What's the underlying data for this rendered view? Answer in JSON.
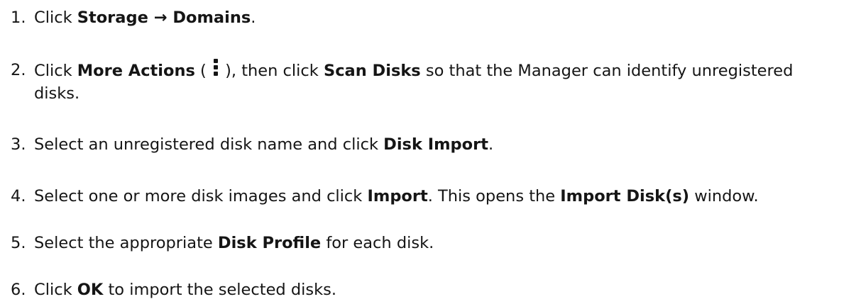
{
  "steps": [
    {
      "number": "1.",
      "t1": "Click ",
      "b1": "Storage → Domains",
      "t2": "."
    },
    {
      "number": "2.",
      "t1": "Click ",
      "b1": "More Actions",
      "t2": " ( ",
      "icon": "kebab-vertical-icon",
      "t3": " ), then click ",
      "b2": "Scan Disks",
      "t4": " so that the Manager can identify unregistered",
      "t5": "disks."
    },
    {
      "number": "3.",
      "t1": "Select an unregistered disk name and click ",
      "b1": "Disk Import",
      "t2": "."
    },
    {
      "number": "4.",
      "t1": "Select one or more disk images and click ",
      "b1": "Import",
      "t2": ". This opens the ",
      "b2": "Import Disk(s)",
      "t3": " window."
    },
    {
      "number": "5.",
      "t1": "Select the appropriate ",
      "b1": "Disk Profile",
      "t2": " for each disk."
    },
    {
      "number": "6.",
      "t1": "Click ",
      "b1": "OK",
      "t2": " to import the selected disks."
    }
  ]
}
